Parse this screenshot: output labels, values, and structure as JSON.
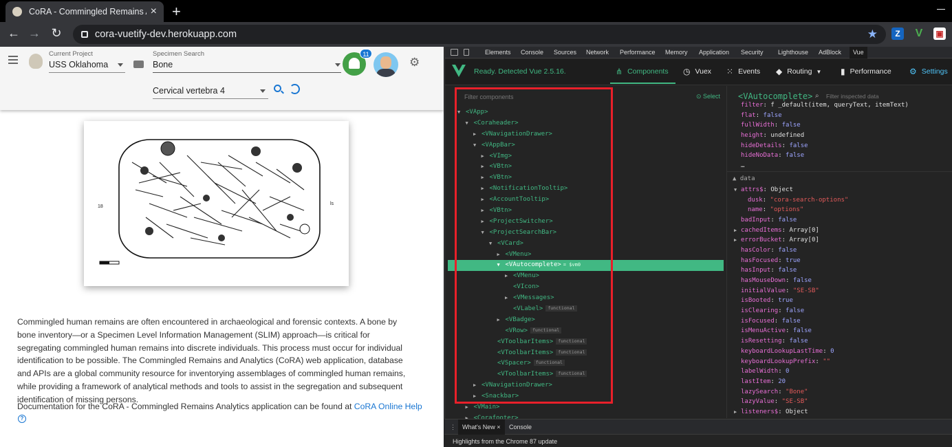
{
  "browser": {
    "tab_title": "CoRA - Commingled Remains An",
    "tab_close": "×",
    "new_tab": "+",
    "url": "cora-vuetify-dev.herokuapp.com",
    "extensions": [
      "Z",
      "V",
      "▣"
    ],
    "extension_colors": [
      "#1565c0",
      "#2e7d32",
      "#c62828"
    ]
  },
  "appbar": {
    "project_label": "Current Project",
    "project_value": "USS Oklahoma",
    "specimen_label": "Specimen Search",
    "specimen_value": "Bone",
    "element_value": "Cervical vertebra 4",
    "notification_count": "11"
  },
  "content": {
    "description": "Commingled human remains are often encountered in archaeological and forensic contexts. A bone by bone inventory—or a Specimen Level Information Management (SLIM) approach—is critical for segregating commingled human remains into discrete individuals. This process must occur for individual identification to be possible. The Commingled Remains and Analytics (CoRA) web application, database and APIs are a global community resource for inventorying assemblages of commingled human remains, while providing a framework of analytical methods and tools to assist in the segregation and subsequent identification of missing persons.",
    "doc_prefix": "Documentation for the CoRA - Commingled Remains Analytics application can be found at ",
    "doc_link": "CoRA Online Help"
  },
  "devtools": {
    "tabs": [
      "Elements",
      "Console",
      "Sources",
      "Network",
      "Performance",
      "Memory",
      "Application",
      "Security",
      "Lighthouse",
      "AdBlock",
      "Vue"
    ],
    "vue_status": "Ready. Detected Vue 2.5.16.",
    "vue_tabs": [
      "Components",
      "Vuex",
      "Events",
      "Routing",
      "Performance",
      "Settings"
    ],
    "filter_components": "Filter components",
    "select": "Select",
    "tree": [
      {
        "depth": 0,
        "arrow": "▼",
        "label": "<VApp>",
        "tag": ""
      },
      {
        "depth": 1,
        "arrow": "▼",
        "label": "<Coraheader>",
        "tag": ""
      },
      {
        "depth": 2,
        "arrow": "▶",
        "label": "<VNavigationDrawer>",
        "tag": ""
      },
      {
        "depth": 2,
        "arrow": "▼",
        "label": "<VAppBar>",
        "tag": ""
      },
      {
        "depth": 3,
        "arrow": "▶",
        "label": "<VImg>",
        "tag": ""
      },
      {
        "depth": 3,
        "arrow": "▶",
        "label": "<VBtn>",
        "tag": ""
      },
      {
        "depth": 3,
        "arrow": "▶",
        "label": "<VBtn>",
        "tag": ""
      },
      {
        "depth": 3,
        "arrow": "▶",
        "label": "<NotificationTooltip>",
        "tag": ""
      },
      {
        "depth": 3,
        "arrow": "▶",
        "label": "<AccountTooltip>",
        "tag": ""
      },
      {
        "depth": 3,
        "arrow": "▶",
        "label": "<VBtn>",
        "tag": ""
      },
      {
        "depth": 3,
        "arrow": "▶",
        "label": "<ProjectSwitcher>",
        "tag": ""
      },
      {
        "depth": 3,
        "arrow": "▼",
        "label": "<ProjectSearchBar>",
        "tag": ""
      },
      {
        "depth": 4,
        "arrow": "▼",
        "label": "<VCard>",
        "tag": ""
      },
      {
        "depth": 5,
        "arrow": "▶",
        "label": "<VMenu>",
        "tag": ""
      },
      {
        "depth": 5,
        "arrow": "▼",
        "label": "<VAutocomplete>",
        "tag": "= $vm0",
        "selected": true
      },
      {
        "depth": 6,
        "arrow": "▶",
        "label": "<VMenu>",
        "tag": ""
      },
      {
        "depth": 6,
        "arrow": "",
        "label": "<VIcon>",
        "tag": ""
      },
      {
        "depth": 6,
        "arrow": "▶",
        "label": "<VMessages>",
        "tag": ""
      },
      {
        "depth": 6,
        "arrow": "",
        "label": "<VLabel>",
        "tag": "functional"
      },
      {
        "depth": 5,
        "arrow": "▶",
        "label": "<VBadge>",
        "tag": ""
      },
      {
        "depth": 5,
        "arrow": "",
        "label": "<VRow>",
        "tag": "functional"
      },
      {
        "depth": 4,
        "arrow": "",
        "label": "<VToolbarItems>",
        "tag": "functional"
      },
      {
        "depth": 4,
        "arrow": "",
        "label": "<VToolbarItems>",
        "tag": "functional"
      },
      {
        "depth": 4,
        "arrow": "",
        "label": "<VSpacer>",
        "tag": "functional"
      },
      {
        "depth": 4,
        "arrow": "",
        "label": "<VToolbarItems>",
        "tag": "functional"
      },
      {
        "depth": 2,
        "arrow": "▶",
        "label": "<VNavigationDrawer>",
        "tag": ""
      },
      {
        "depth": 2,
        "arrow": "▶",
        "label": "<Snackbar>",
        "tag": ""
      },
      {
        "depth": 1,
        "arrow": "▶",
        "label": "<VMain>",
        "tag": ""
      },
      {
        "depth": 1,
        "arrow": "▶",
        "label": "<Corafooter>",
        "tag": ""
      }
    ],
    "inspected_title": "<VAutocomplete>",
    "filter_inspected": "Filter inspected data",
    "props": [
      {
        "key": "filter",
        "val": "f _default(item, queryText, itemText)",
        "t": "plain",
        "partial": true
      },
      {
        "key": "flat",
        "val": "false",
        "t": "b"
      },
      {
        "key": "fullWidth",
        "val": "false",
        "t": "b"
      },
      {
        "key": "height",
        "val": "undefined",
        "t": "plain"
      },
      {
        "key": "hideDetails",
        "val": "false",
        "t": "b"
      },
      {
        "key": "hideNoData",
        "val": "false",
        "t": "b"
      }
    ],
    "ellipsis": "…",
    "data_section": "data",
    "data": [
      {
        "key": "attrs$",
        "val": "Object",
        "t": "plain",
        "arrow": "▼",
        "indent": 0
      },
      {
        "key": "dusk",
        "val": "\"cora-search-options\"",
        "t": "s",
        "indent": 1
      },
      {
        "key": "name",
        "val": "\"options\"",
        "t": "s",
        "indent": 1
      },
      {
        "key": "badInput",
        "val": "false",
        "t": "b",
        "indent": 0
      },
      {
        "key": "cachedItems",
        "val": "Array[0]",
        "t": "plain",
        "arrow": "▶",
        "indent": 0
      },
      {
        "key": "errorBucket",
        "val": "Array[0]",
        "t": "plain",
        "arrow": "▶",
        "indent": 0
      },
      {
        "key": "hasColor",
        "val": "false",
        "t": "b",
        "indent": 0
      },
      {
        "key": "hasFocused",
        "val": "true",
        "t": "b",
        "indent": 0
      },
      {
        "key": "hasInput",
        "val": "false",
        "t": "b",
        "indent": 0
      },
      {
        "key": "hasMouseDown",
        "val": "false",
        "t": "b",
        "indent": 0
      },
      {
        "key": "initialValue",
        "val": "\"SE-SB\"",
        "t": "s",
        "indent": 0
      },
      {
        "key": "isBooted",
        "val": "true",
        "t": "b",
        "indent": 0
      },
      {
        "key": "isClearing",
        "val": "false",
        "t": "b",
        "indent": 0
      },
      {
        "key": "isFocused",
        "val": "false",
        "t": "b",
        "indent": 0
      },
      {
        "key": "isMenuActive",
        "val": "false",
        "t": "b",
        "indent": 0
      },
      {
        "key": "isResetting",
        "val": "false",
        "t": "b",
        "indent": 0
      },
      {
        "key": "keyboardLookupLastTime",
        "val": "0",
        "t": "n",
        "indent": 0
      },
      {
        "key": "keyboardLookupPrefix",
        "val": "\"\"",
        "t": "s",
        "indent": 0
      },
      {
        "key": "labelWidth",
        "val": "0",
        "t": "n",
        "indent": 0
      },
      {
        "key": "lastItem",
        "val": "20",
        "t": "n",
        "indent": 0
      },
      {
        "key": "lazySearch",
        "val": "\"Bone\"",
        "t": "s",
        "indent": 0
      },
      {
        "key": "lazyValue",
        "val": "\"SE-SB\"",
        "t": "s",
        "indent": 0
      },
      {
        "key": "listeners$",
        "val": "Object",
        "t": "plain",
        "arrow": "▶",
        "indent": 0
      }
    ],
    "drawer_tabs": [
      "What's New",
      "Console"
    ],
    "drawer_close": "×",
    "highlights": "Highlights from the Chrome 87 update"
  }
}
